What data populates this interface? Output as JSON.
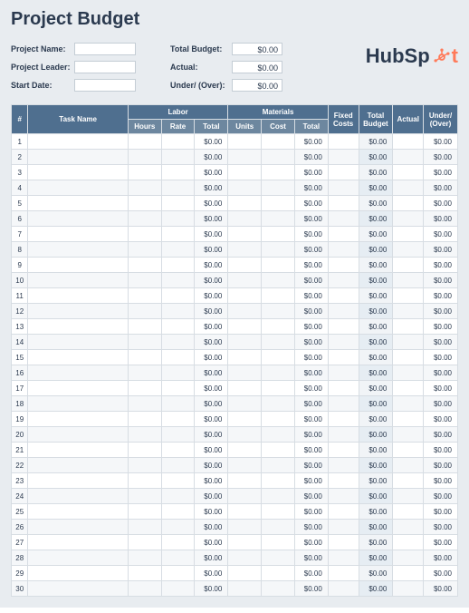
{
  "title": "Project Budget",
  "meta": {
    "projectNameLabel": "Project Name:",
    "projectLeaderLabel": "Project Leader:",
    "startDateLabel": "Start Date:"
  },
  "totals": {
    "totalBudgetLabel": "Total Budget:",
    "totalBudgetValue": "$0.00",
    "actualLabel": "Actual:",
    "actualValue": "$0.00",
    "underOverLabel": "Under/ (Over):",
    "underOverValue": "$0.00"
  },
  "brand": {
    "text": "HubSp",
    "suffix": "t"
  },
  "columns": {
    "num": "#",
    "task": "Task Name",
    "laborGroup": "Labor",
    "hours": "Hours",
    "rate": "Rate",
    "laborTotal": "Total",
    "materialsGroup": "Materials",
    "units": "Units",
    "cost": "Cost",
    "materialsTotal": "Total",
    "fixed": "Fixed Costs",
    "total": "Total Budget",
    "actual": "Actual",
    "under": "Under/ (Over)"
  },
  "rows": [
    {
      "n": "1",
      "ltot": "$0.00",
      "mtot": "$0.00",
      "total": "$0.00",
      "under": "$0.00"
    },
    {
      "n": "2",
      "ltot": "$0.00",
      "mtot": "$0.00",
      "total": "$0.00",
      "under": "$0.00"
    },
    {
      "n": "3",
      "ltot": "$0.00",
      "mtot": "$0.00",
      "total": "$0.00",
      "under": "$0.00"
    },
    {
      "n": "4",
      "ltot": "$0.00",
      "mtot": "$0.00",
      "total": "$0.00",
      "under": "$0.00"
    },
    {
      "n": "5",
      "ltot": "$0.00",
      "mtot": "$0.00",
      "total": "$0.00",
      "under": "$0.00"
    },
    {
      "n": "6",
      "ltot": "$0.00",
      "mtot": "$0.00",
      "total": "$0.00",
      "under": "$0.00"
    },
    {
      "n": "7",
      "ltot": "$0.00",
      "mtot": "$0.00",
      "total": "$0.00",
      "under": "$0.00"
    },
    {
      "n": "8",
      "ltot": "$0.00",
      "mtot": "$0.00",
      "total": "$0.00",
      "under": "$0.00"
    },
    {
      "n": "9",
      "ltot": "$0.00",
      "mtot": "$0.00",
      "total": "$0.00",
      "under": "$0.00"
    },
    {
      "n": "10",
      "ltot": "$0.00",
      "mtot": "$0.00",
      "total": "$0.00",
      "under": "$0.00"
    },
    {
      "n": "11",
      "ltot": "$0.00",
      "mtot": "$0.00",
      "total": "$0.00",
      "under": "$0.00"
    },
    {
      "n": "12",
      "ltot": "$0.00",
      "mtot": "$0.00",
      "total": "$0.00",
      "under": "$0.00"
    },
    {
      "n": "13",
      "ltot": "$0.00",
      "mtot": "$0.00",
      "total": "$0.00",
      "under": "$0.00"
    },
    {
      "n": "14",
      "ltot": "$0.00",
      "mtot": "$0.00",
      "total": "$0.00",
      "under": "$0.00"
    },
    {
      "n": "15",
      "ltot": "$0.00",
      "mtot": "$0.00",
      "total": "$0.00",
      "under": "$0.00"
    },
    {
      "n": "16",
      "ltot": "$0.00",
      "mtot": "$0.00",
      "total": "$0.00",
      "under": "$0.00"
    },
    {
      "n": "17",
      "ltot": "$0.00",
      "mtot": "$0.00",
      "total": "$0.00",
      "under": "$0.00"
    },
    {
      "n": "18",
      "ltot": "$0.00",
      "mtot": "$0.00",
      "total": "$0.00",
      "under": "$0.00"
    },
    {
      "n": "19",
      "ltot": "$0.00",
      "mtot": "$0.00",
      "total": "$0.00",
      "under": "$0.00"
    },
    {
      "n": "20",
      "ltot": "$0.00",
      "mtot": "$0.00",
      "total": "$0.00",
      "under": "$0.00"
    },
    {
      "n": "21",
      "ltot": "$0.00",
      "mtot": "$0.00",
      "total": "$0.00",
      "under": "$0.00"
    },
    {
      "n": "22",
      "ltot": "$0.00",
      "mtot": "$0.00",
      "total": "$0.00",
      "under": "$0.00"
    },
    {
      "n": "23",
      "ltot": "$0.00",
      "mtot": "$0.00",
      "total": "$0.00",
      "under": "$0.00"
    },
    {
      "n": "24",
      "ltot": "$0.00",
      "mtot": "$0.00",
      "total": "$0.00",
      "under": "$0.00"
    },
    {
      "n": "25",
      "ltot": "$0.00",
      "mtot": "$0.00",
      "total": "$0.00",
      "under": "$0.00"
    },
    {
      "n": "26",
      "ltot": "$0.00",
      "mtot": "$0.00",
      "total": "$0.00",
      "under": "$0.00"
    },
    {
      "n": "27",
      "ltot": "$0.00",
      "mtot": "$0.00",
      "total": "$0.00",
      "under": "$0.00"
    },
    {
      "n": "28",
      "ltot": "$0.00",
      "mtot": "$0.00",
      "total": "$0.00",
      "under": "$0.00"
    },
    {
      "n": "29",
      "ltot": "$0.00",
      "mtot": "$0.00",
      "total": "$0.00",
      "under": "$0.00"
    },
    {
      "n": "30",
      "ltot": "$0.00",
      "mtot": "$0.00",
      "total": "$0.00",
      "under": "$0.00"
    }
  ]
}
